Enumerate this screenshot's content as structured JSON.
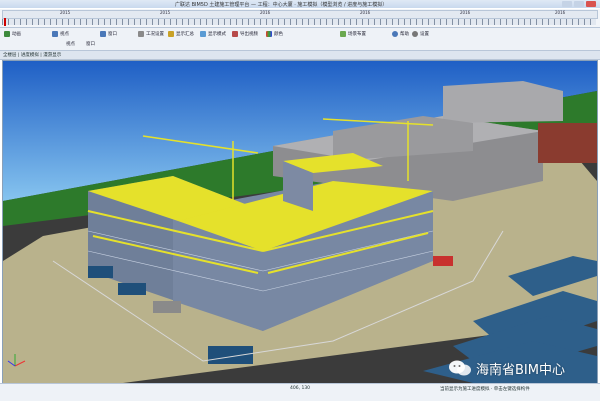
{
  "app": {
    "title": "广联达 BIM5D 土建施工管理平台 — 工程：中心大厦 · 施工模拟（模型浏览 / 进度与施工模拟）"
  },
  "timeline": {
    "labels": [
      "2015",
      "2015",
      "2016",
      "2016",
      "2016",
      "2016"
    ]
  },
  "toolbar": {
    "items": [
      {
        "label": "动画",
        "icon": "play-icon"
      },
      {
        "label": "视点",
        "icon": "camera-icon"
      },
      {
        "label": "窗口",
        "icon": "window-icon"
      },
      {
        "label": "工况设置",
        "icon": "settings-icon"
      },
      {
        "label": "显示汇总",
        "icon": "summary-icon"
      },
      {
        "label": "显示模式",
        "icon": "display-icon"
      },
      {
        "label": "导出视频",
        "icon": "video-icon"
      },
      {
        "label": "颜色",
        "icon": "color-icon"
      },
      {
        "label": "场景布置",
        "icon": "scene-icon"
      },
      {
        "label": "帮助",
        "icon": "help-icon"
      },
      {
        "label": "设置",
        "icon": "gear-icon"
      }
    ],
    "row2": [
      "视点",
      "窗口"
    ]
  },
  "panel": {
    "header": "全楼层 | 进度模拟 | 漫游显示"
  },
  "viewport": {
    "accent_yellow": "#e5e12b",
    "sky_top": "#1f5fc5",
    "sky_bottom": "#86c4ef",
    "grass": "#2d7a2b"
  },
  "status": {
    "left": "",
    "center": "406, 130",
    "right": "当前显示为施工进度模拟 · 单击左键选择构件"
  },
  "watermark": {
    "text": "海南省BIM中心",
    "icon": "wechat-icon"
  }
}
